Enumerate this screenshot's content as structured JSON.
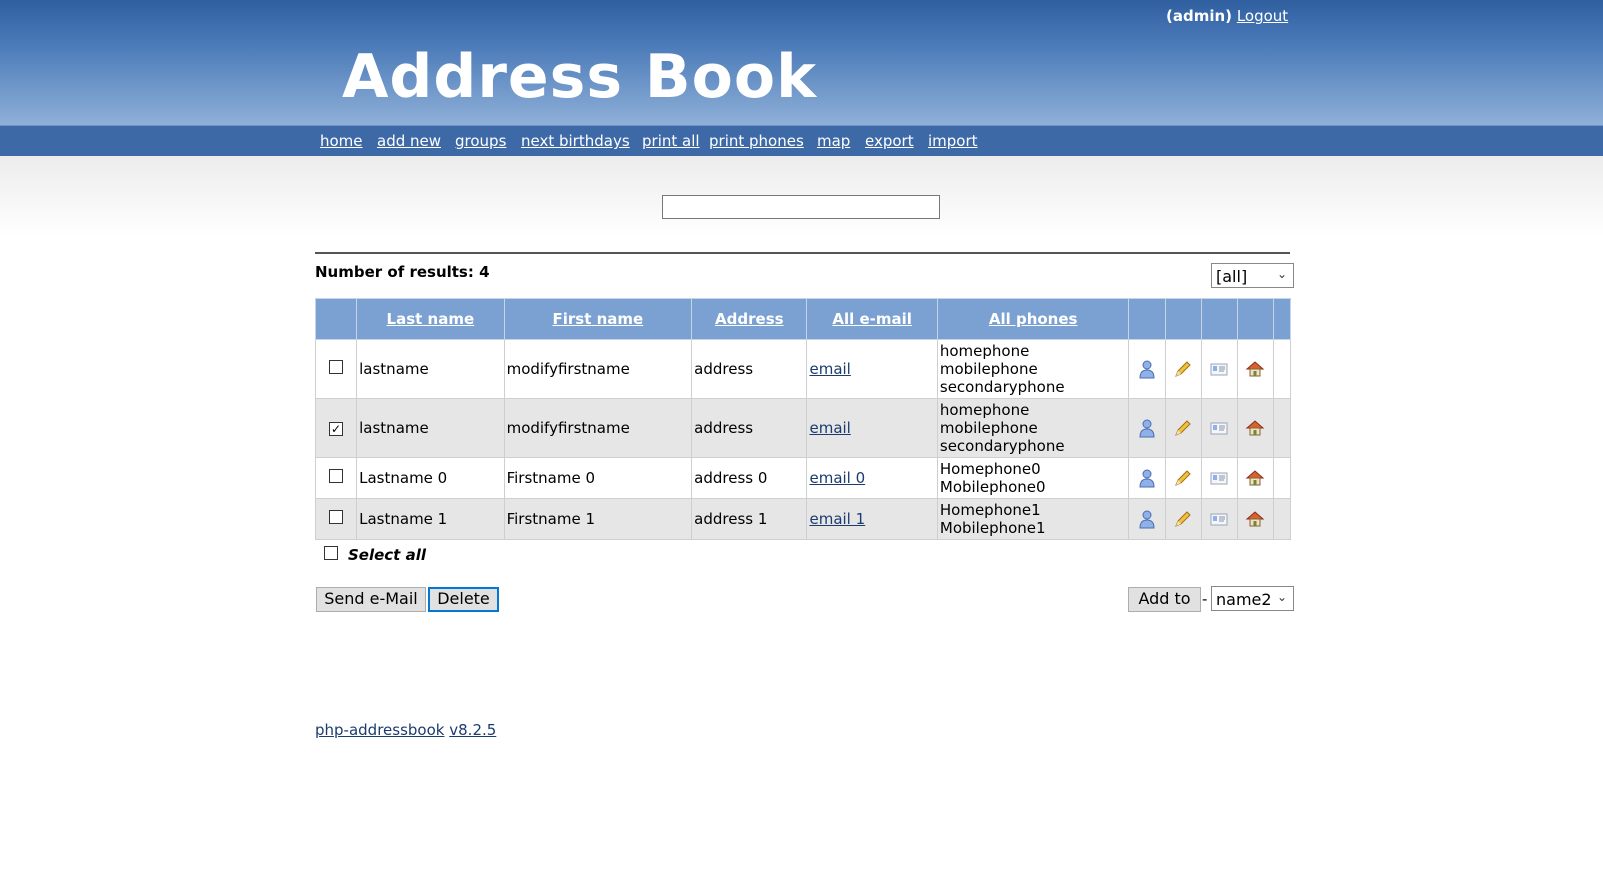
{
  "header": {
    "user": "(admin)",
    "logout": "Logout",
    "logo": "Address Book"
  },
  "nav": {
    "items": [
      "home",
      "add new",
      "groups",
      "next birthdays",
      "print all",
      "print phones",
      "map",
      "export",
      "import"
    ]
  },
  "search": {
    "value": ""
  },
  "results": {
    "label": "Number of results: 4"
  },
  "group_filter": {
    "selected": "[all]"
  },
  "table": {
    "headers": [
      "Last name",
      "First name",
      "Address",
      "All e-mail",
      "All phones"
    ],
    "rows": [
      {
        "checked": false,
        "last": "lastname",
        "first": "modifyfirstname",
        "address": "address",
        "email": "email",
        "phones": [
          "homephone",
          "mobilephone",
          "secondaryphone"
        ]
      },
      {
        "checked": true,
        "last": "lastname",
        "first": "modifyfirstname",
        "address": "address",
        "email": "email",
        "phones": [
          "homephone",
          "mobilephone",
          "secondaryphone"
        ]
      },
      {
        "checked": false,
        "last": "Lastname 0",
        "first": "Firstname 0",
        "address": "address 0",
        "email": "email 0",
        "phones": [
          "Homephone0",
          "Mobilephone0"
        ]
      },
      {
        "checked": false,
        "last": "Lastname 1",
        "first": "Firstname 1",
        "address": "address 1",
        "email": "email 1",
        "phones": [
          "Homephone1",
          "Mobilephone1"
        ]
      }
    ],
    "row_icons": [
      "person-icon",
      "pencil-icon",
      "vcard-icon",
      "house-icon"
    ]
  },
  "select_all": {
    "label": "Select all"
  },
  "actions": {
    "send_email": "Send e-Mail",
    "delete": "Delete",
    "add_to": "Add to",
    "separator": "-",
    "group_target": "name2"
  },
  "footer": {
    "app": "php-addressbook",
    "version": "v8.2.5"
  },
  "colors": {
    "header_top": "#2f5f9f",
    "nav_bar": "#3d6aa7",
    "table_header": "#7aa1d2",
    "row_alt": "#e6e6e6",
    "link": "#1a3c6e"
  }
}
